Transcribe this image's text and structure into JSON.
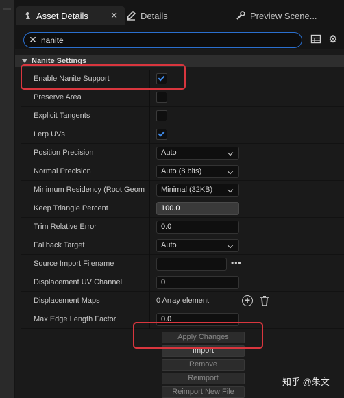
{
  "tabs": [
    {
      "label": "Asset Details",
      "icon": "asset-details-icon",
      "active": true
    },
    {
      "label": "Details",
      "icon": "pencil-icon"
    },
    {
      "label": "Preview Scene...",
      "icon": "wrench-icon"
    }
  ],
  "search": {
    "value": "nanite"
  },
  "section": {
    "title": "Nanite Settings"
  },
  "properties": [
    {
      "label": "Enable Nanite Support",
      "type": "checkbox",
      "checked": true
    },
    {
      "label": "Preserve Area",
      "type": "checkbox",
      "checked": false
    },
    {
      "label": "Explicit Tangents",
      "type": "checkbox",
      "checked": false
    },
    {
      "label": "Lerp UVs",
      "type": "checkbox",
      "checked": true
    },
    {
      "label": "Position Precision",
      "type": "dropdown",
      "value": "Auto"
    },
    {
      "label": "Normal Precision",
      "type": "dropdown",
      "value": "Auto (8 bits)"
    },
    {
      "label": "Minimum Residency (Root Geom",
      "type": "dropdown",
      "value": "Minimal (32KB)"
    },
    {
      "label": "Keep Triangle Percent",
      "type": "slider",
      "value": "100.0"
    },
    {
      "label": "Trim Relative Error",
      "type": "number",
      "value": "0.0"
    },
    {
      "label": "Fallback Target",
      "type": "dropdown",
      "value": "Auto"
    },
    {
      "label": "Source Import Filename",
      "type": "file",
      "value": ""
    },
    {
      "label": "Displacement UV Channel",
      "type": "number",
      "value": "0"
    },
    {
      "label": "Displacement Maps",
      "type": "array",
      "value": "0 Array element"
    },
    {
      "label": "Max Edge Length Factor",
      "type": "number",
      "value": "0.0"
    }
  ],
  "buttons": {
    "apply": "Apply Changes",
    "import": "Import",
    "remove": "Remove",
    "reimport": "Reimport",
    "reimport_new": "Reimport New File"
  },
  "watermark": "知乎 @朱文",
  "colors": {
    "accent": "#3f8ae8",
    "highlight": "#d9363e",
    "search_border": "#2a6fce"
  }
}
